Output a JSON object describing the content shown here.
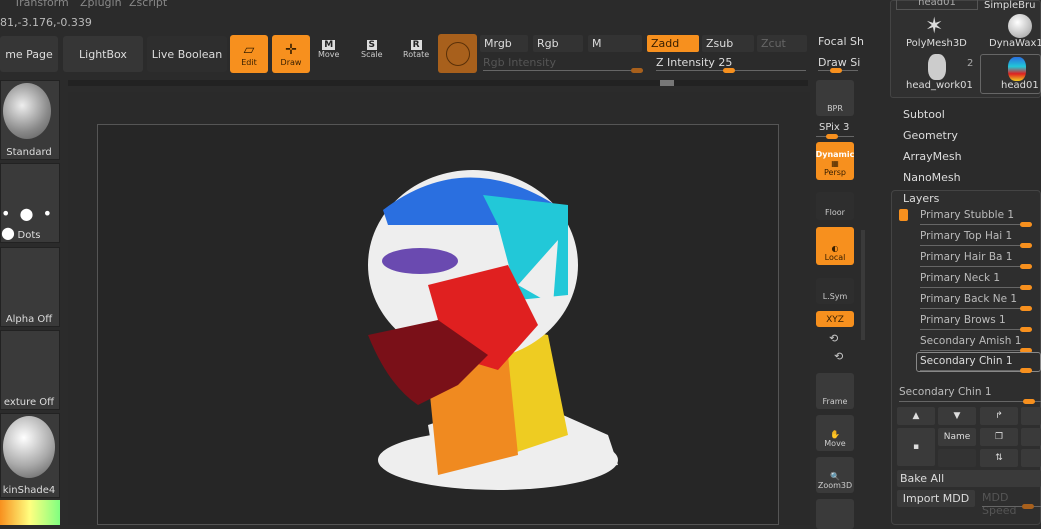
{
  "menu": [
    "Transform",
    "Zplugin",
    "Zscript"
  ],
  "coords": "81,-3.176,-0.339",
  "toolbar": {
    "home_page": "me Page",
    "lightbox": "LightBox",
    "live_boolean": "Live Boolean",
    "edit": "Edit",
    "draw": "Draw",
    "move": "Move",
    "scale": "Scale",
    "rotate": "Rotate",
    "mrgb": "Mrgb",
    "rgb": "Rgb",
    "m": "M",
    "zadd": "Zadd",
    "zsub": "Zsub",
    "zcut": "Zcut",
    "rgb_intensity": "Rgb Intensity",
    "z_intensity": "Z Intensity 25",
    "focal_shift": "Focal Sh",
    "draw_size": "Draw Si"
  },
  "left_shelf": [
    "Standard",
    "Dots",
    "Alpha Off",
    "exture Off",
    "kinShade4"
  ],
  "right_shelf": {
    "bpr": "BPR",
    "spix": "SPix 3",
    "dynamic": "Dynamic",
    "persp": "Persp",
    "floor": "Floor",
    "local": "Local",
    "lsym": "L.Sym",
    "xyz": "XYZ",
    "frame": "Frame",
    "move": "Move",
    "zoom3d": "Zoom3D"
  },
  "tools": {
    "top_left": "head01",
    "top_right": "SimpleBru",
    "polymesh": "PolyMesh3D",
    "dynawax": "DynaWax1",
    "head_work": "head_work01",
    "head_work_count": "2",
    "head01": "head01"
  },
  "panel": {
    "items": [
      "Subtool",
      "Geometry",
      "ArrayMesh",
      "NanoMesh"
    ],
    "layers_title": "Layers",
    "layers": [
      "Primary Stubble 1",
      "Primary Top Hai 1",
      "Primary Hair Ba 1",
      "Primary Neck 1",
      "Primary Back Ne 1",
      "Primary Brows 1",
      "Secondary Amish 1",
      "Secondary Chin 1"
    ],
    "selected_layer": "Secondary Chin 1",
    "name_btn": "Name",
    "bake_all": "Bake All",
    "import_mdd": "Import MDD",
    "mdd_speed": "MDD Speed"
  },
  "colors": {
    "accent": "#f7901e",
    "background": "#2b2b2b"
  }
}
